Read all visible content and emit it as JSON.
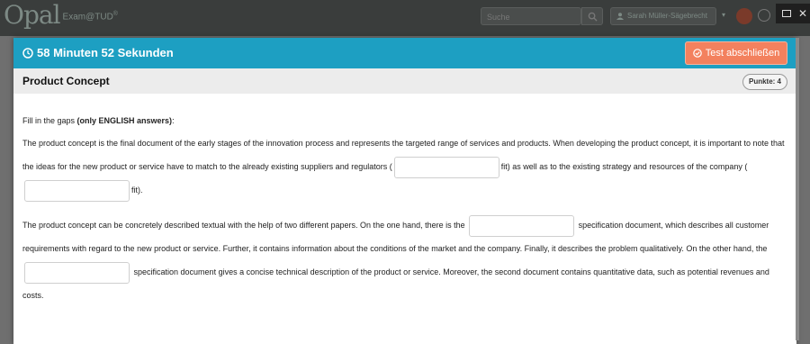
{
  "topbar": {
    "logo_mark": "Opal",
    "logo_text": "Exam@TUD",
    "logo_sup": "®",
    "search_placeholder": "Suche",
    "user_name": "Sarah Müller-Sägebrecht"
  },
  "modal": {
    "timer_text": "58 Minuten 52 Sekunden",
    "finish_label": "Test abschließen",
    "question_title": "Product Concept",
    "points_label": "Punkte: 4",
    "instruction_prefix": "Fill in the gaps ",
    "instruction_bold": "(only ENGLISH answers)",
    "instruction_suffix": ":",
    "p1_a": "The product concept is the final document of the early stages of the innovation process and represents the targeted range of services and products. When developing the product concept, it is important to note that the ideas for the new product or service have to match to the already existing suppliers and regulators (",
    "p1_b": "fit) as well as to the existing strategy and resources of the company (",
    "p1_c": "fit).",
    "p2_a": "The product concept can be concretely described textual with the help of two different papers. On the one hand, there is the",
    "p2_b": "specification document, which describes all customer requirements with regard to the new product or service. Further, it contains information about the conditions of the market and the company. Finally, it describes the problem qualitatively. On the other hand, the",
    "p2_c": "specification document gives a concise technical description of the product or service. Moreover, the second document contains quantitative data, such as potential revenues and costs.",
    "gaps": [
      "",
      "",
      "",
      ""
    ]
  },
  "colors": {
    "timer_bar": "#1d9fc2",
    "finish_button": "#f3815e",
    "header_bg": "#ececec"
  },
  "icons": [
    "search-icon",
    "user-icon",
    "clock-icon",
    "check-circle-icon",
    "notification-icon",
    "help-icon"
  ]
}
